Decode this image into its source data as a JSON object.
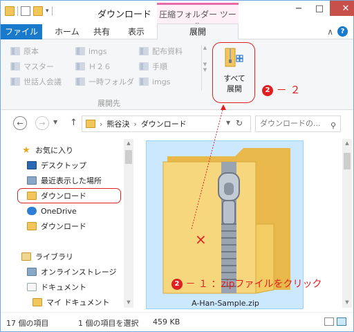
{
  "titlebar": {
    "title": "ダウンロード",
    "context_tab": "圧縮フォルダー ツール",
    "controls": {
      "minimize": "−",
      "maximize": "□",
      "close": "✕"
    }
  },
  "ribbon_tabs": {
    "file": "ファイル",
    "home": "ホーム",
    "share": "共有",
    "view": "表示",
    "extract": "展開"
  },
  "ribbon": {
    "destinations": [
      "原本",
      "imgs",
      "配布資料",
      "マスター",
      "Ｈ２６",
      "手順",
      "世話人会議",
      "一時フォルダ",
      "imgs"
    ],
    "extract_all_label": "すべて\n展開",
    "extract_all_line1": "すべて",
    "extract_all_line2": "展開",
    "group_label": "展開先",
    "annotation": "－ ２",
    "annotation_num": "2"
  },
  "address": {
    "path": [
      "熊谷決",
      "ダウンロード"
    ],
    "search_placeholder": "ダウンロードの..."
  },
  "nav": {
    "favorites": "お気に入り",
    "desktop": "デスクトップ",
    "recent": "最近表示した場所",
    "downloads": "ダウンロード",
    "onedrive": "OneDrive",
    "downloads2": "ダウンロード",
    "libraries": "ライブラリ",
    "online_storage": "オンラインストレージ",
    "documents": "ドキュメント",
    "my_documents": "マイ ドキュメント"
  },
  "content": {
    "file_name": "A-Han-Sample.zip",
    "annotation": "－ １ ：zipファイルをクリック",
    "annotation_num": "2",
    "x_mark": "×"
  },
  "status": {
    "count": "17 個の項目",
    "selected": "1 個の項目を選択",
    "size": "459 KB"
  },
  "colors": {
    "accent": "#1979ca",
    "annotation": "#e02020",
    "selection": "#cce8ff"
  }
}
